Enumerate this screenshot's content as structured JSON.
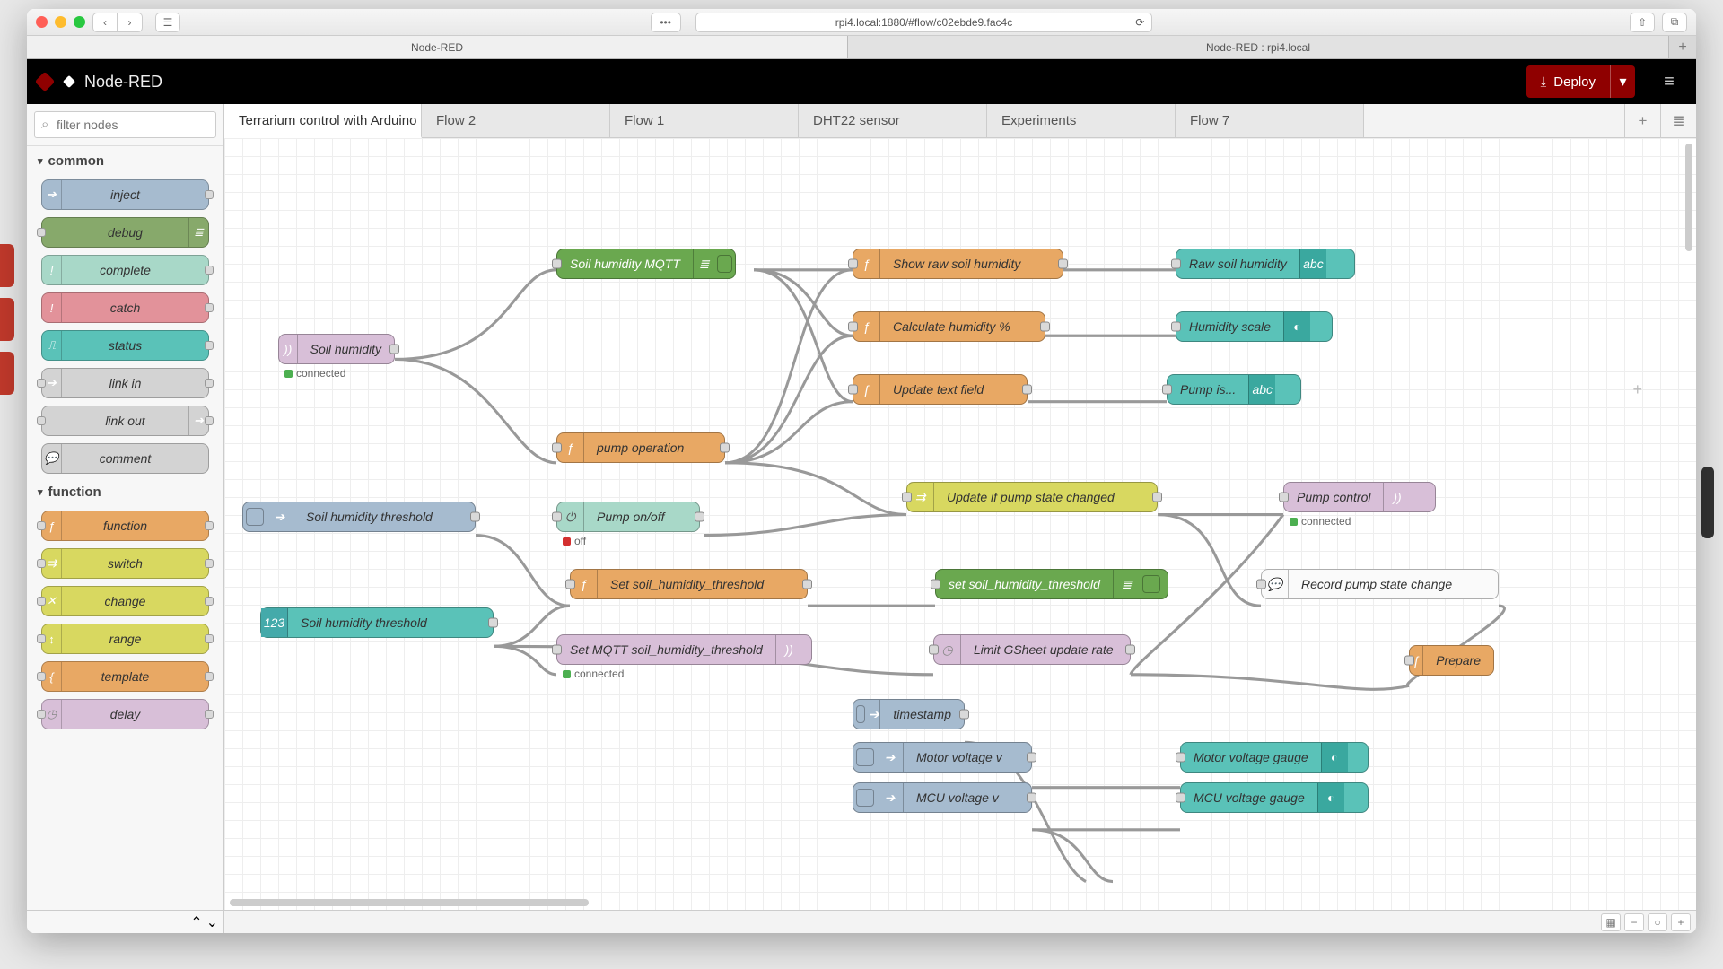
{
  "browser": {
    "url": "rpi4.local:1880/#flow/c02ebde9.fac4c",
    "tabs": [
      "Node-RED",
      "Node-RED : rpi4.local"
    ]
  },
  "app": {
    "title": "Node-RED",
    "deploy": "Deploy"
  },
  "palette": {
    "filter_placeholder": "filter nodes",
    "cat_common": "common",
    "cat_function": "function",
    "common": {
      "inject": "inject",
      "debug": "debug",
      "complete": "complete",
      "catch": "catch",
      "status": "status",
      "link_in": "link in",
      "link_out": "link out",
      "comment": "comment"
    },
    "func": {
      "function": "function",
      "switch": "switch",
      "change": "change",
      "range": "range",
      "template": "template",
      "delay": "delay"
    }
  },
  "flow_tabs": {
    "t1": "Terrarium control with Arduino",
    "t2": "Flow 2",
    "t3": "Flow 1",
    "t4": "DHT22 sensor",
    "t5": "Experiments",
    "t6": "Flow 7"
  },
  "nodes": {
    "soil_humidity": "Soil humidity",
    "soil_humidity_status": "connected",
    "soil_humidity_mqtt": "Soil humidity MQTT",
    "show_raw": "Show raw soil humidity",
    "raw_soil": "Raw soil humidity",
    "calc_hum": "Calculate humidity %",
    "hum_scale": "Humidity scale",
    "update_text": "Update text field",
    "pump_is": "Pump is...",
    "pump_op": "pump operation",
    "update_if_changed": "Update if pump state changed",
    "pump_control": "Pump control",
    "pump_control_status": "connected",
    "thresh_inject": "Soil humidity threshold",
    "thresh_numeric": "Soil humidity threshold",
    "pump_onoff": "Pump on/off",
    "pump_onoff_status": "off",
    "set_thresh_fn": "Set soil_humidity_threshold",
    "set_thresh_debug": "set soil_humidity_threshold",
    "set_mqtt_thresh": "Set MQTT soil_humidity_threshold",
    "set_mqtt_status": "connected",
    "record_pump": "Record pump state change",
    "limit_gsheet": "Limit GSheet update rate",
    "prepare": "Prepare",
    "timestamp": "timestamp",
    "motor_v": "Motor voltage v",
    "mcu_v": "MCU voltage v",
    "motor_gauge": "Motor voltage gauge",
    "mcu_gauge": "MCU voltage gauge"
  },
  "colors": {
    "status_green": "#4caf50",
    "status_red": "#d32f2f"
  }
}
